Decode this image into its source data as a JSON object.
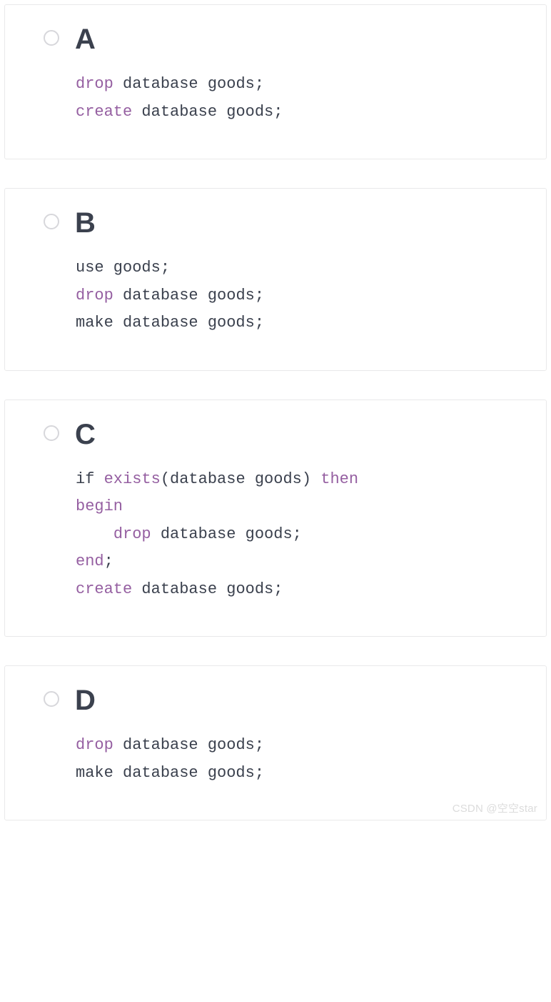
{
  "options": {
    "a": {
      "letter": "A",
      "code": [
        {
          "t": "kw",
          "v": "drop"
        },
        {
          "t": "n",
          "v": " database goods;"
        },
        {
          "t": "br"
        },
        {
          "t": "kw",
          "v": "create"
        },
        {
          "t": "n",
          "v": " database goods;"
        }
      ]
    },
    "b": {
      "letter": "B",
      "code": [
        {
          "t": "n",
          "v": "use goods;"
        },
        {
          "t": "br"
        },
        {
          "t": "kw",
          "v": "drop"
        },
        {
          "t": "n",
          "v": " database goods;"
        },
        {
          "t": "br"
        },
        {
          "t": "n",
          "v": "make database goods;"
        }
      ]
    },
    "c": {
      "letter": "C",
      "code": [
        {
          "t": "n",
          "v": "if "
        },
        {
          "t": "kw",
          "v": "exists"
        },
        {
          "t": "n",
          "v": "(database goods) "
        },
        {
          "t": "kw",
          "v": "then"
        },
        {
          "t": "br"
        },
        {
          "t": "kw",
          "v": "begin"
        },
        {
          "t": "br"
        },
        {
          "t": "n",
          "v": "    "
        },
        {
          "t": "kw",
          "v": "drop"
        },
        {
          "t": "n",
          "v": " database goods;"
        },
        {
          "t": "br"
        },
        {
          "t": "kw",
          "v": "end"
        },
        {
          "t": "n",
          "v": ";"
        },
        {
          "t": "br"
        },
        {
          "t": "kw",
          "v": "create"
        },
        {
          "t": "n",
          "v": " database goods;"
        }
      ]
    },
    "d": {
      "letter": "D",
      "code": [
        {
          "t": "kw",
          "v": "drop"
        },
        {
          "t": "n",
          "v": " database goods;"
        },
        {
          "t": "br"
        },
        {
          "t": "n",
          "v": "make database goods;"
        }
      ]
    }
  },
  "watermark": "CSDN @空空star"
}
